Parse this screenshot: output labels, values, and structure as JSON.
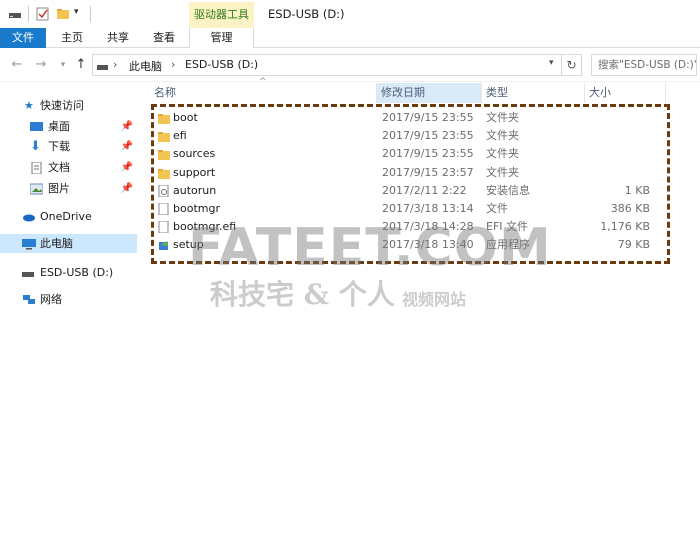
{
  "window": {
    "title": "ESD-USB (D:)",
    "context_tab": "驱动器工具"
  },
  "ribbon": {
    "tabs": [
      "文件",
      "主页",
      "共享",
      "查看",
      "管理"
    ]
  },
  "address": {
    "segments": [
      "此电脑",
      "ESD-USB (D:)"
    ],
    "search_placeholder": "搜索\"ESD-USB (D:)\""
  },
  "nav": {
    "quick_access": "快速访问",
    "items": [
      {
        "label": "桌面",
        "pinned": true
      },
      {
        "label": "下载",
        "pinned": true
      },
      {
        "label": "文档",
        "pinned": true
      },
      {
        "label": "图片",
        "pinned": true
      }
    ],
    "onedrive": "OneDrive",
    "this_pc": "此电脑",
    "usb": "ESD-USB (D:)",
    "network": "网络"
  },
  "columns": {
    "name": "名称",
    "date": "修改日期",
    "type": "类型",
    "size": "大小"
  },
  "files": [
    {
      "name": "boot",
      "date": "2017/9/15 23:55",
      "type": "文件夹",
      "size": "",
      "icon": "folder-icon"
    },
    {
      "name": "efi",
      "date": "2017/9/15 23:55",
      "type": "文件夹",
      "size": "",
      "icon": "folder-icon"
    },
    {
      "name": "sources",
      "date": "2017/9/15 23:55",
      "type": "文件夹",
      "size": "",
      "icon": "folder-icon"
    },
    {
      "name": "support",
      "date": "2017/9/15 23:57",
      "type": "文件夹",
      "size": "",
      "icon": "folder-icon"
    },
    {
      "name": "autorun",
      "date": "2017/2/11 2:22",
      "type": "安装信息",
      "size": "1 KB",
      "icon": "setup-info-icon"
    },
    {
      "name": "bootmgr",
      "date": "2017/3/18 13:14",
      "type": "文件",
      "size": "386 KB",
      "icon": "file-icon"
    },
    {
      "name": "bootmgr.efi",
      "date": "2017/3/18 14:28",
      "type": "EFI 文件",
      "size": "1,176 KB",
      "icon": "file-icon"
    },
    {
      "name": "setup",
      "date": "2017/3/18 13:40",
      "type": "应用程序",
      "size": "79 KB",
      "icon": "setup-app-icon"
    }
  ],
  "watermark": {
    "line1": "FATEET.COM",
    "line2": "科技宅 & 个人",
    "line3": "视频网站"
  },
  "colors": {
    "file_tab": "#1979ca",
    "context_tab_bg": "#fbf3c5",
    "selection": "#cce8ff",
    "highlight_box": "#6b3a0e"
  }
}
